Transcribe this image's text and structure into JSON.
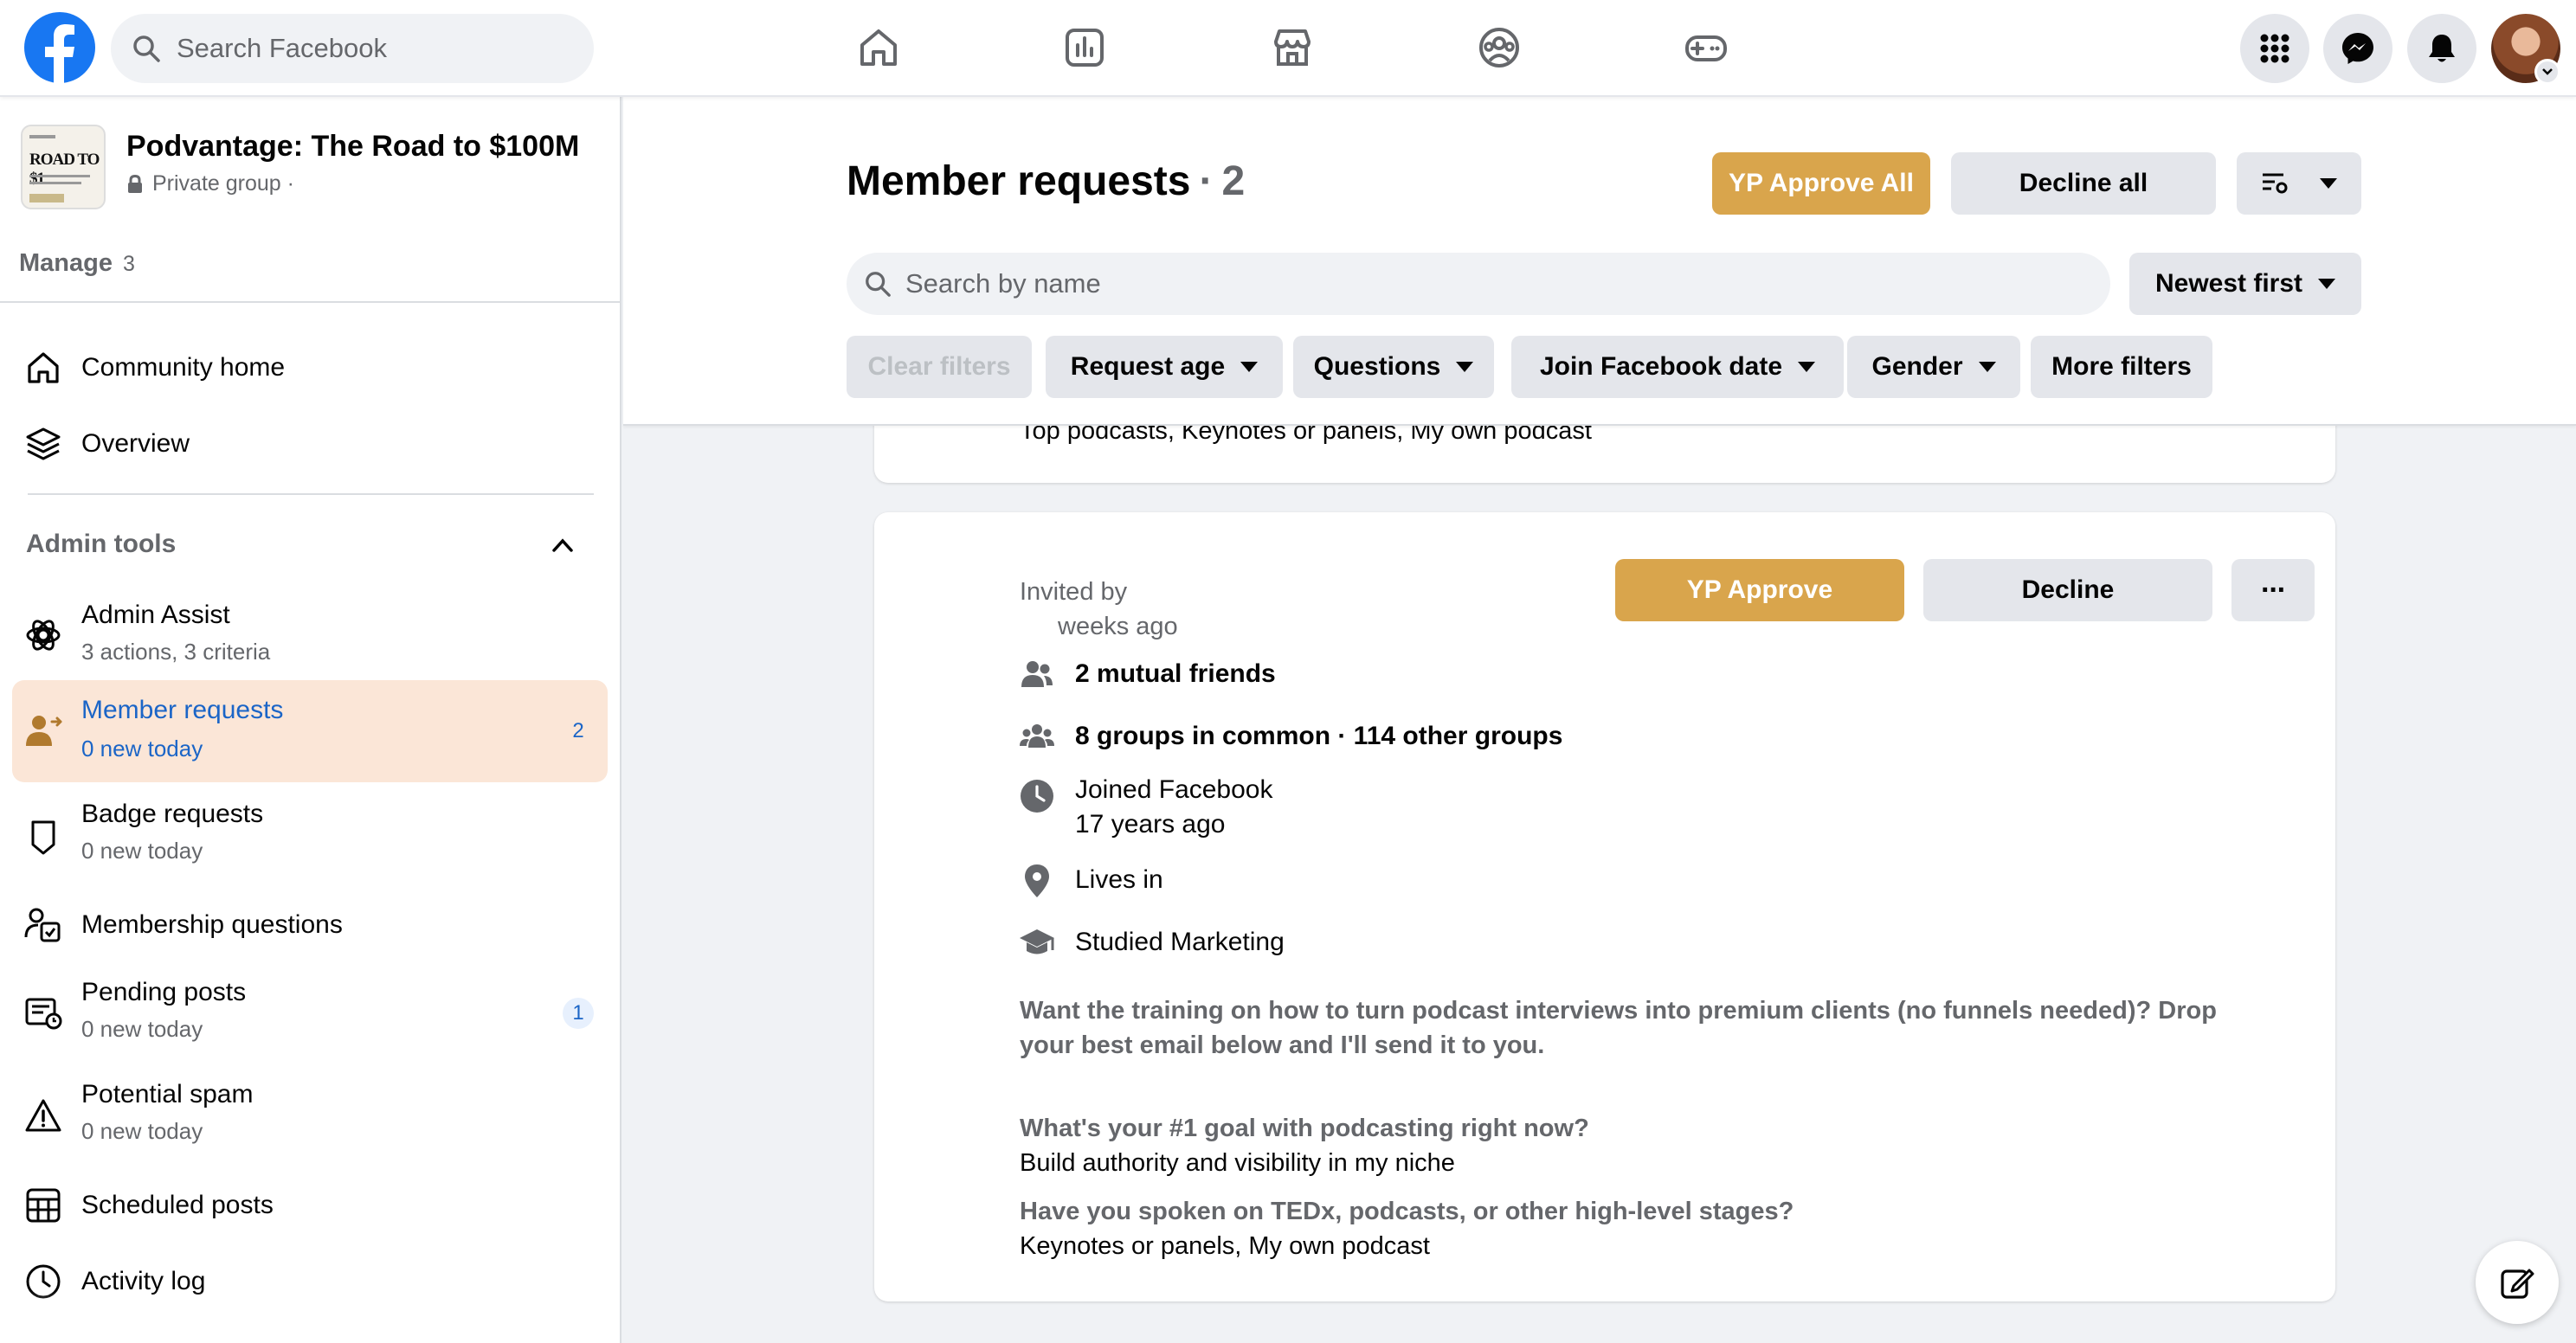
{
  "topbar": {
    "search_placeholder": "Search Facebook",
    "nav_icons": [
      "home-icon",
      "pages-icon",
      "marketplace-icon",
      "groups-icon",
      "gaming-icon"
    ],
    "right_icons": [
      "menu-grid-icon",
      "messenger-icon",
      "notifications-icon"
    ],
    "brand_color": "#1877f2"
  },
  "group": {
    "name": "Podvantage: The Road to $100M",
    "privacy": "Private group ·",
    "thumb_text": "ROAD TO $1"
  },
  "sidebar": {
    "manage_label": "Manage",
    "manage_count": "3",
    "community_home": "Community home",
    "overview": "Overview",
    "admin_tools": "Admin tools",
    "items": [
      {
        "label": "Admin Assist",
        "sub": "3 actions, 3 criteria"
      },
      {
        "label": "Member requests",
        "sub": "0 new today",
        "badge": "2",
        "active": true
      },
      {
        "label": "Badge requests",
        "sub": "0 new today"
      },
      {
        "label": "Membership questions",
        "sub": ""
      },
      {
        "label": "Pending posts",
        "sub": "0 new today",
        "badge": "1"
      },
      {
        "label": "Potential spam",
        "sub": "0 new today"
      },
      {
        "label": "Scheduled posts",
        "sub": ""
      },
      {
        "label": "Activity log",
        "sub": ""
      }
    ],
    "active_bg": "#fbe6d7",
    "active_text": "#1b65c7"
  },
  "header": {
    "title": "Member requests",
    "separator": "·",
    "count": "2",
    "approve_all": "YP Approve All",
    "decline_all": "Decline all",
    "search_placeholder": "Search by name",
    "sort": "Newest first",
    "filters": {
      "clear": "Clear filters",
      "request_age": "Request age",
      "questions": "Questions",
      "join_date": "Join Facebook date",
      "gender": "Gender",
      "more": "More filters"
    },
    "accent": "#d9a54c"
  },
  "prev_card": {
    "answer": "Top podcasts, Keynotes or panels, My own podcast"
  },
  "request": {
    "invited_by": "Invited by",
    "time": "weeks ago",
    "approve": "YP Approve",
    "decline": "Decline",
    "more": "···",
    "mutual_friends": "2 mutual friends",
    "groups_common": "8 groups in common · 114 other groups",
    "joined_label": "Joined Facebook",
    "joined_time": "17 years ago",
    "lives_in": "Lives in",
    "studied": "Studied Marketing",
    "promo_line1": "Want the training on how to turn podcast interviews into premium clients (no funnels needed)? Drop",
    "promo_line2": "your best email below and I'll send it to you.",
    "q1": "What's your #1 goal with podcasting right now?",
    "a1": "Build authority and visibility in my niche",
    "q2": "Have you spoken on TEDx, podcasts, or other high-level stages?",
    "a2": "Keynotes or panels, My own podcast"
  }
}
